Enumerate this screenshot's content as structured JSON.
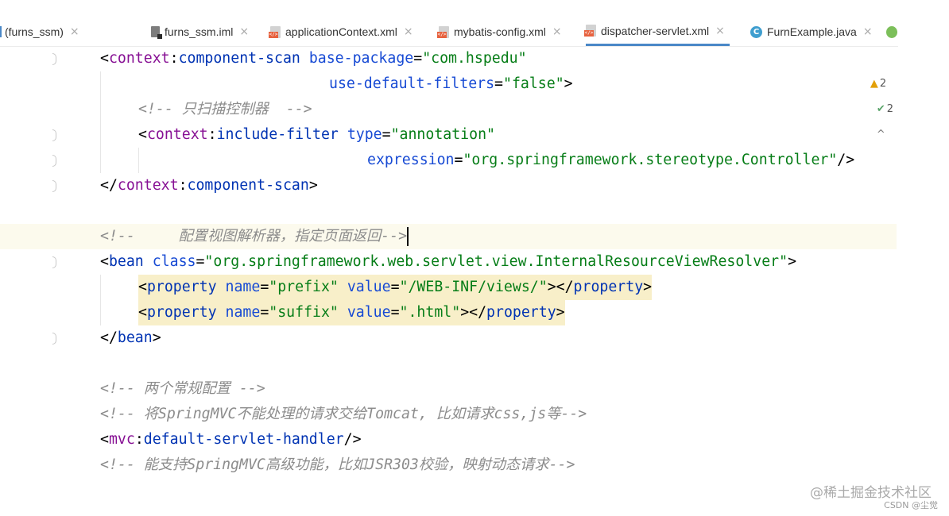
{
  "tabs": [
    {
      "label": "(furns_ssm)",
      "icon": "module-icon"
    },
    {
      "label": "furns_ssm.iml",
      "icon": "iml-file-icon"
    },
    {
      "label": "applicationContext.xml",
      "icon": "xml-file-icon"
    },
    {
      "label": "mybatis-config.xml",
      "icon": "xml-file-icon"
    },
    {
      "label": "dispatcher-servlet.xml",
      "icon": "xml-file-icon",
      "active": true
    },
    {
      "label": "FurnExample.java",
      "icon": "java-class-icon"
    }
  ],
  "close_glyph": "×",
  "class_icon_letter": "C",
  "inspections": {
    "warnings": "2",
    "weak_warnings": "2"
  },
  "colors": {
    "tag": "#0033b3",
    "namespace": "#871094",
    "attribute": "#174ad4",
    "string": "#067d17",
    "comment": "#8c8c8c",
    "caret_line": "#fcfaed",
    "highlight": "#f8efc9",
    "active_tab_underline": "#4a88c7"
  },
  "code": {
    "l1": {
      "open": "<",
      "ns": "context",
      "colon": ":",
      "tag": "component-scan",
      "attr": " base-package",
      "eq": "=",
      "val": "\"com.hspedu\""
    },
    "l2": {
      "attr": "use-default-filters",
      "eq": "=",
      "val": "\"false\"",
      "close": ">"
    },
    "l3": {
      "comment": "<!-- 只扫描控制器  -->"
    },
    "l4": {
      "open": "<",
      "ns": "context",
      "colon": ":",
      "tag": "include-filter",
      "attr": " type",
      "eq": "=",
      "val": "\"annotation\""
    },
    "l5": {
      "attr": "expression",
      "eq": "=",
      "val": "\"org.springframework.stereotype.Controller\"",
      "close": "/>"
    },
    "l6": {
      "open": "</",
      "ns": "context",
      "colon": ":",
      "tag": "component-scan",
      "close": ">"
    },
    "l8": {
      "comment": "<!--     配置视图解析器，指定页面返回-->"
    },
    "l9": {
      "open": "<",
      "tag": "bean",
      "attr": " class",
      "eq": "=",
      "val": "\"org.springframework.web.servlet.view.InternalResourceViewResolver\"",
      "close": ">"
    },
    "l10": {
      "open": "<",
      "tag": "property",
      "attr1": " name",
      "eq1": "=",
      "val1": "\"prefix\"",
      "attr2": " value",
      "eq2": "=",
      "val2": "\"/WEB-INF/views/\"",
      "mid": "></",
      "tag2": "property",
      "close": ">"
    },
    "l11": {
      "open": "<",
      "tag": "property",
      "attr1": " name",
      "eq1": "=",
      "val1": "\"suffix\"",
      "attr2": " value",
      "eq2": "=",
      "val2": "\".html\"",
      "mid": "></",
      "tag2": "property",
      "close": ">"
    },
    "l12": {
      "open": "</",
      "tag": "bean",
      "close": ">"
    },
    "l14": {
      "comment": "<!-- 两个常规配置 -->"
    },
    "l15": {
      "comment": "<!-- 将SpringMVC不能处理的请求交给Tomcat, 比如请求css,js等-->"
    },
    "l16": {
      "open": "<",
      "ns": "mvc",
      "colon": ":",
      "tag": "default-servlet-handler",
      "close": "/>"
    },
    "l17": {
      "comment": "<!-- 能支持SpringMVC高级功能，比如JSR303校验，映射动态请求-->"
    }
  },
  "watermark": {
    "main": "@稀土掘金技术社区",
    "sub": "CSDN @尘觉"
  }
}
